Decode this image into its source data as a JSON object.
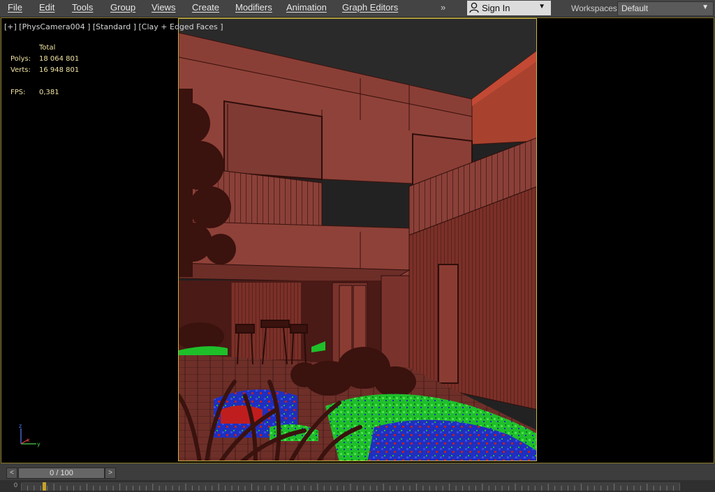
{
  "menu": {
    "items": [
      "File",
      "Edit",
      "Tools",
      "Group",
      "Views",
      "Create",
      "Modifiers",
      "Animation",
      "Graph Editors"
    ],
    "overflow": "»"
  },
  "account": {
    "sign_in": "Sign In"
  },
  "workspaces": {
    "label": "Workspaces:",
    "value": "Default"
  },
  "viewport": {
    "label": "[+] [PhysCamera004 ] [Standard ] [Clay + Edged Faces ]",
    "stats": {
      "header": "Total",
      "polys_label": "Polys:",
      "polys_value": "18 064 801",
      "verts_label": "Verts:",
      "verts_value": "16 948 801",
      "fps_label": "FPS:",
      "fps_value": "0,381"
    },
    "gizmo_axes": [
      "z",
      "x",
      "y"
    ]
  },
  "timeline": {
    "prev": "<",
    "next": ">",
    "frame": "0 / 100",
    "track_start": "0"
  },
  "colors": {
    "accent": "#c9b342",
    "clay": "#8a3f36",
    "foliage_green": "#1fbf2a",
    "foliage_blue": "#1f2fc0",
    "foliage_red": "#c01e1e"
  }
}
